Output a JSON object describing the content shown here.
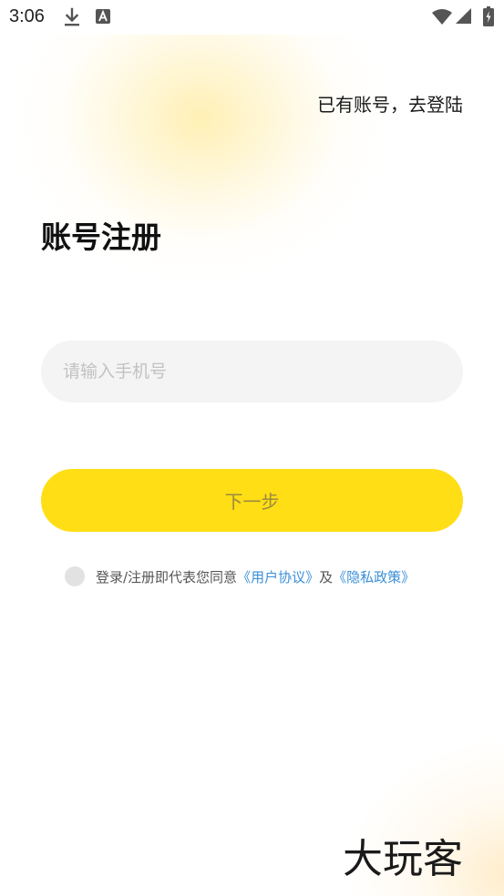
{
  "status_bar": {
    "time": "3:06",
    "icons": [
      "download-icon",
      "a-icon",
      "wifi-icon",
      "signal-icon",
      "battery-icon"
    ]
  },
  "header": {
    "login_link": "已有账号，去登陆"
  },
  "main": {
    "title": "账号注册",
    "phone_input": {
      "placeholder": "请输入手机号",
      "value": ""
    },
    "next_button": "下一步"
  },
  "agreement": {
    "checked": false,
    "prefix": "登录/注册即代表您同意",
    "user_agreement": "《用户协议》",
    "conjunction": "及",
    "privacy_policy": "《隐私政策》"
  },
  "watermark": {
    "text": "大玩客"
  },
  "colors": {
    "accent": "#ffde16",
    "button_text": "#9b8a3c",
    "link": "#3a8fd8",
    "input_bg": "#f4f4f4"
  }
}
